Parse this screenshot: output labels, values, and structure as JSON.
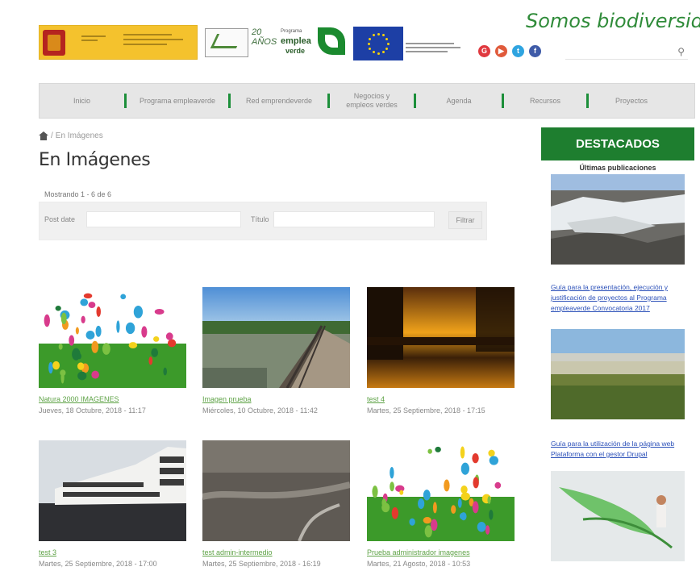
{
  "site": {
    "title": "Somos biodiversidad"
  },
  "logos": {
    "anniversary": "20 AÑOS",
    "programa_top": "Programa",
    "programa_main": "emplea",
    "programa_bottom": "verde"
  },
  "social": [
    {
      "icon": "google-plus-icon",
      "glyph": "G",
      "color": "#e0393f"
    },
    {
      "icon": "youtube-icon",
      "glyph": "▶",
      "color": "#e05a3b"
    },
    {
      "icon": "twitter-icon",
      "glyph": "t",
      "color": "#2fa4e0"
    },
    {
      "icon": "facebook-icon",
      "glyph": "f",
      "color": "#3f5ba8"
    }
  ],
  "search": {
    "placeholder": ""
  },
  "nav": [
    "Inicio",
    "Programa empleaverde",
    "Red emprendeverde",
    "Negocios y empleos verdes",
    "Agenda",
    "Recursos",
    "Proyectos"
  ],
  "breadcrumb": {
    "current": "En Imágenes"
  },
  "page": {
    "title": "En Imágenes",
    "count": "Mostrando 1 - 6 de 6"
  },
  "filter": {
    "post_date_label": "Post date",
    "title_label": "Título",
    "button": "Filtrar"
  },
  "gallery": [
    {
      "title": "Natura 2000 IMAGENES",
      "date": "Jueves, 18 Octubre, 2018 - 11:17"
    },
    {
      "title": "Imagen prueba",
      "date": "Miércoles, 10 Octubre, 2018 - 11:42"
    },
    {
      "title": "test 4",
      "date": "Martes, 25 Septiembre, 2018 - 17:15"
    },
    {
      "title": "test 3",
      "date": "Martes, 25 Septiembre, 2018 - 17:00"
    },
    {
      "title": "test admin-intermedio",
      "date": "Martes, 25 Septiembre, 2018 - 16:19"
    },
    {
      "title": "Prueba administrador imagenes",
      "date": "Martes, 21 Agosto, 2018 - 10:53"
    }
  ],
  "sidebar": {
    "heading": "DESTACADOS",
    "subheading": "Últimas publicaciones",
    "link1": "Guía para la presentación, ejecución y justificación de proyectos al Programa empleaverde Convocatoria 2017",
    "link2": "Guía para la utilización de la página web Plataforma con el gestor Drupal"
  },
  "colors": {
    "brand_green": "#1e7e2f",
    "link_green": "#5fa347",
    "link_blue": "#2a4fb8"
  }
}
